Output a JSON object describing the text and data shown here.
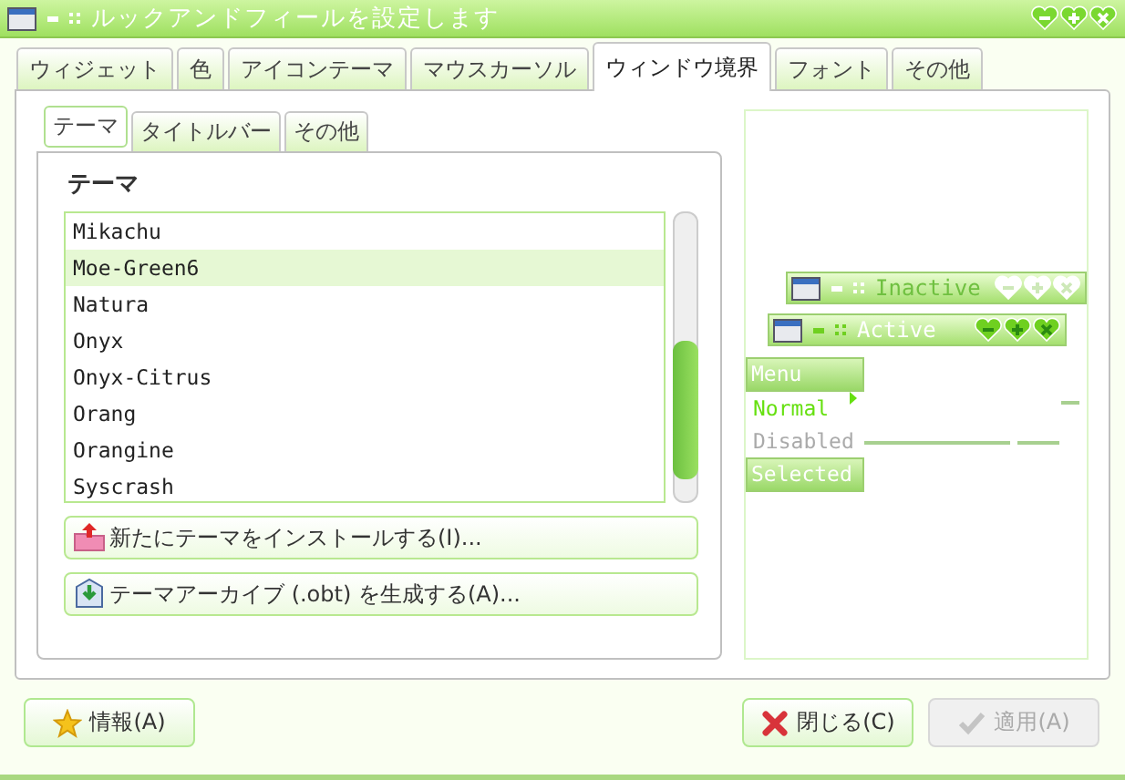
{
  "window": {
    "title": "ルックアンドフィールを設定します"
  },
  "tabs": [
    {
      "label": "ウィジェット",
      "selected": false
    },
    {
      "label": "色",
      "selected": false
    },
    {
      "label": "アイコンテーマ",
      "selected": false
    },
    {
      "label": "マウスカーソル",
      "selected": false
    },
    {
      "label": "ウィンドウ境界",
      "selected": true
    },
    {
      "label": "フォント",
      "selected": false
    },
    {
      "label": "その他",
      "selected": false
    }
  ],
  "subtabs": [
    {
      "label": "テーマ",
      "selected": true
    },
    {
      "label": "タイトルバー",
      "selected": false
    },
    {
      "label": "その他",
      "selected": false
    }
  ],
  "theme_list": {
    "label": "テーマ",
    "items": [
      {
        "name": "Mikachu",
        "selected": false
      },
      {
        "name": "Moe-Green6",
        "selected": true
      },
      {
        "name": "Natura",
        "selected": false
      },
      {
        "name": "Onyx",
        "selected": false
      },
      {
        "name": "Onyx-Citrus",
        "selected": false
      },
      {
        "name": "Orang",
        "selected": false
      },
      {
        "name": "Orangine",
        "selected": false
      },
      {
        "name": "Syscrash",
        "selected": false
      }
    ]
  },
  "actions": [
    {
      "label": "新たにテーマをインストールする(I)...",
      "kind": "install"
    },
    {
      "label": "テーマアーカイブ (.obt) を生成する(A)...",
      "kind": "archive"
    }
  ],
  "preview": {
    "inactive_title": "Inactive",
    "active_title": "Active",
    "menu": {
      "title": "Menu",
      "items": [
        {
          "label": "Normal",
          "kind": "normal"
        },
        {
          "label": "Disabled",
          "kind": "disabled"
        },
        {
          "label": "Selected",
          "kind": "selected"
        }
      ]
    }
  },
  "buttons": [
    {
      "label": "情報(A)",
      "kind": "about",
      "disabled": false
    },
    {
      "label": "閉じる(C)",
      "kind": "close",
      "disabled": false
    },
    {
      "label": "適用(A)",
      "kind": "apply",
      "disabled": true
    }
  ]
}
